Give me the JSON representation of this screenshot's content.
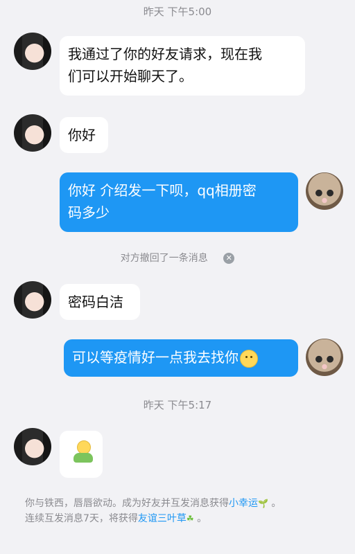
{
  "chat": {
    "timestamp1": "昨天 下午5:00",
    "timestamp2": "昨天 下午5:17",
    "messages": [
      {
        "text": "我通过了你的好友请求，现在我们可以开始聊天了。",
        "line1": "我通过了你的好友请求，现在我",
        "line2": "们可以开始聊天了。"
      },
      {
        "text": "你好"
      },
      {
        "line1": "你好 介绍发一下呗，qq相册密",
        "line2": "码多少"
      },
      {
        "text": "对方撤回了一条消息"
      },
      {
        "text": "密码白洁"
      },
      {
        "text": "可以等疫情好一点我去找你"
      }
    ],
    "footer": {
      "line1_prefix": "你与铁西，唇唇欲动。成为好友并互发消息获得",
      "line1_link": "小幸运",
      "line1_suffix": "。",
      "line2_prefix": "连续互发消息7天，将获得",
      "line2_link": "友谊三叶草",
      "line2_suffix": "。"
    },
    "icons": {
      "recall_close": "close-icon",
      "lucky_leaf": "sprout-icon",
      "clover": "clover-icon"
    }
  }
}
